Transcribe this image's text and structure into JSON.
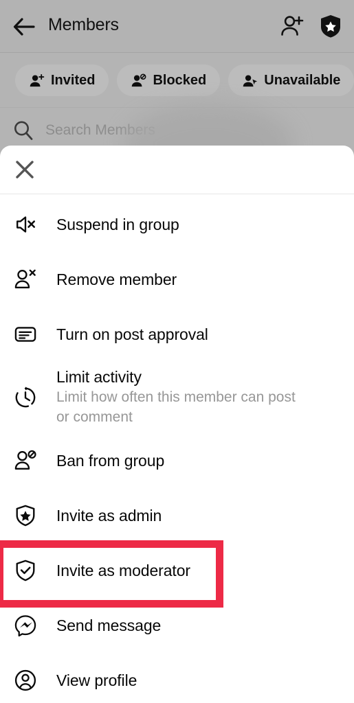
{
  "background_screen": {
    "title": "Members",
    "back_icon": "arrow-left-icon",
    "actions": [
      {
        "name": "add-member-icon",
        "icon": "person-add-icon"
      },
      {
        "name": "admin-shield-icon",
        "icon": "shield-star-filled-icon"
      }
    ],
    "filters": [
      {
        "label": "Invited",
        "icon": "person-plus-icon"
      },
      {
        "label": "Blocked",
        "icon": "person-block-icon"
      },
      {
        "label": "Unavailable",
        "icon": "person-cursor-icon"
      }
    ],
    "search": {
      "placeholder": "Search Members",
      "icon": "search-icon"
    }
  },
  "sheet": {
    "close_icon": "close-icon",
    "title": "",
    "title_state": "blurred",
    "menu_items": [
      {
        "label": "Suspend in group",
        "subtitle": "",
        "icon": "speaker-mute-icon"
      },
      {
        "label": "Remove member",
        "subtitle": "",
        "icon": "person-remove-icon"
      },
      {
        "label": "Turn on post approval",
        "subtitle": "",
        "icon": "post-approval-icon"
      },
      {
        "label": "Limit activity",
        "subtitle": "Limit how often this member can post or comment",
        "icon": "timer-clock-icon"
      },
      {
        "label": "Ban from group",
        "subtitle": "",
        "icon": "person-ban-icon"
      },
      {
        "label": "Invite as admin",
        "subtitle": "",
        "icon": "shield-star-icon"
      },
      {
        "label": "Invite as moderator",
        "subtitle": "",
        "icon": "shield-check-icon"
      },
      {
        "label": "Send message",
        "subtitle": "",
        "icon": "messenger-icon"
      },
      {
        "label": "View profile",
        "subtitle": "",
        "icon": "profile-circle-icon"
      }
    ]
  },
  "annotation": {
    "highlight_target": "Invite as moderator",
    "highlight_color": "#ed2a46"
  },
  "colors": {
    "scrim": "#b4b4b4",
    "sheet_bg": "#ffffff",
    "primary_text": "#080808",
    "secondary_text": "#979797",
    "pill_bg": "#bcbcbc",
    "highlight": "#ed2a46"
  }
}
